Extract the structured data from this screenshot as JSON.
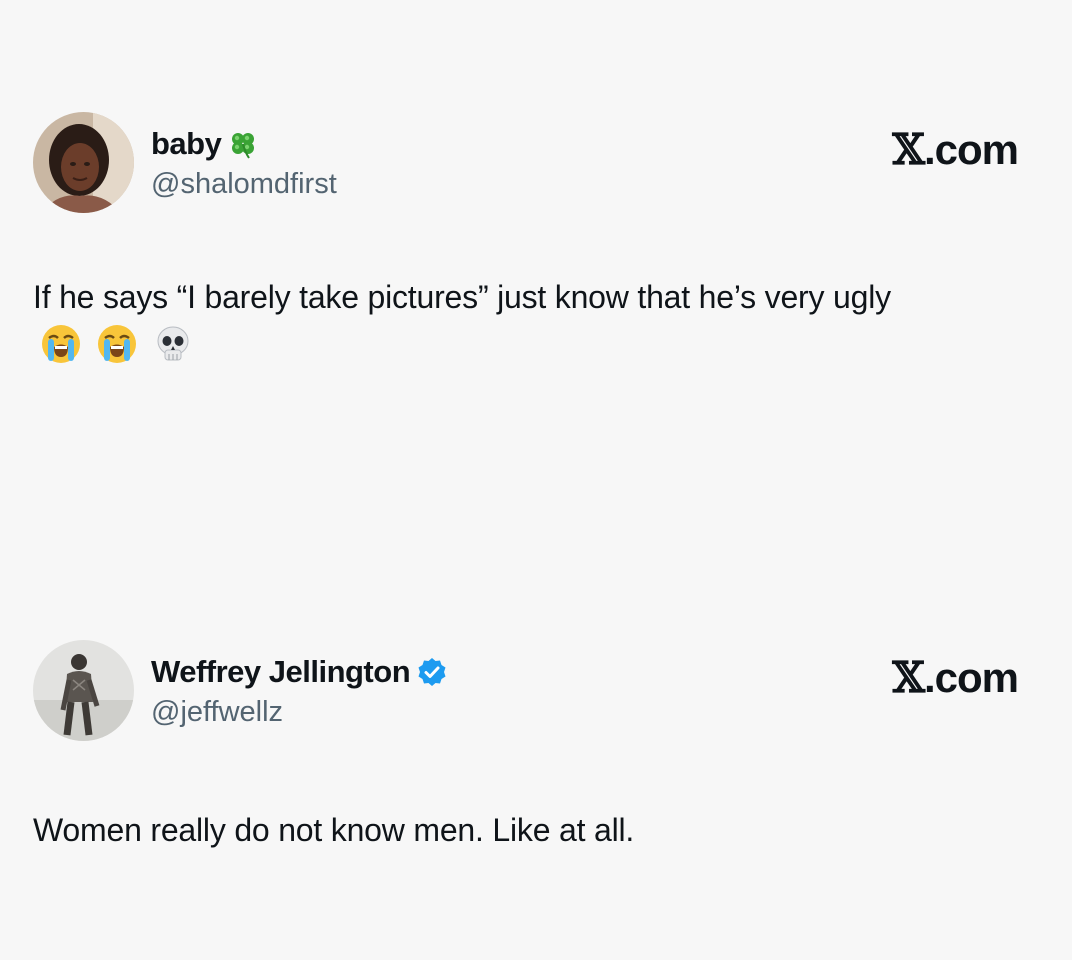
{
  "tweets": [
    {
      "display_name": "baby",
      "name_icon": "four-leaf-clover-icon",
      "handle": "@shalomdfirst",
      "brand_x": "𝕏",
      "brand_suffix": ".com",
      "text": "If he says “I barely take pictures” just know that he’s very ugly",
      "emojis": [
        "loudly-crying-face-icon",
        "loudly-crying-face-icon",
        "skull-icon"
      ]
    },
    {
      "display_name": "Weffrey Jellington",
      "name_icon": "verified-badge-icon",
      "handle": "@jeffwellz",
      "brand_x": "𝕏",
      "brand_suffix": ".com",
      "text": "Women really do not know men. Like at all."
    }
  ],
  "colors": {
    "background": "#f7f7f7",
    "text": "#0f1419",
    "handle": "#536471",
    "verified": "#1d9bf0",
    "clover": "#3aa335"
  }
}
